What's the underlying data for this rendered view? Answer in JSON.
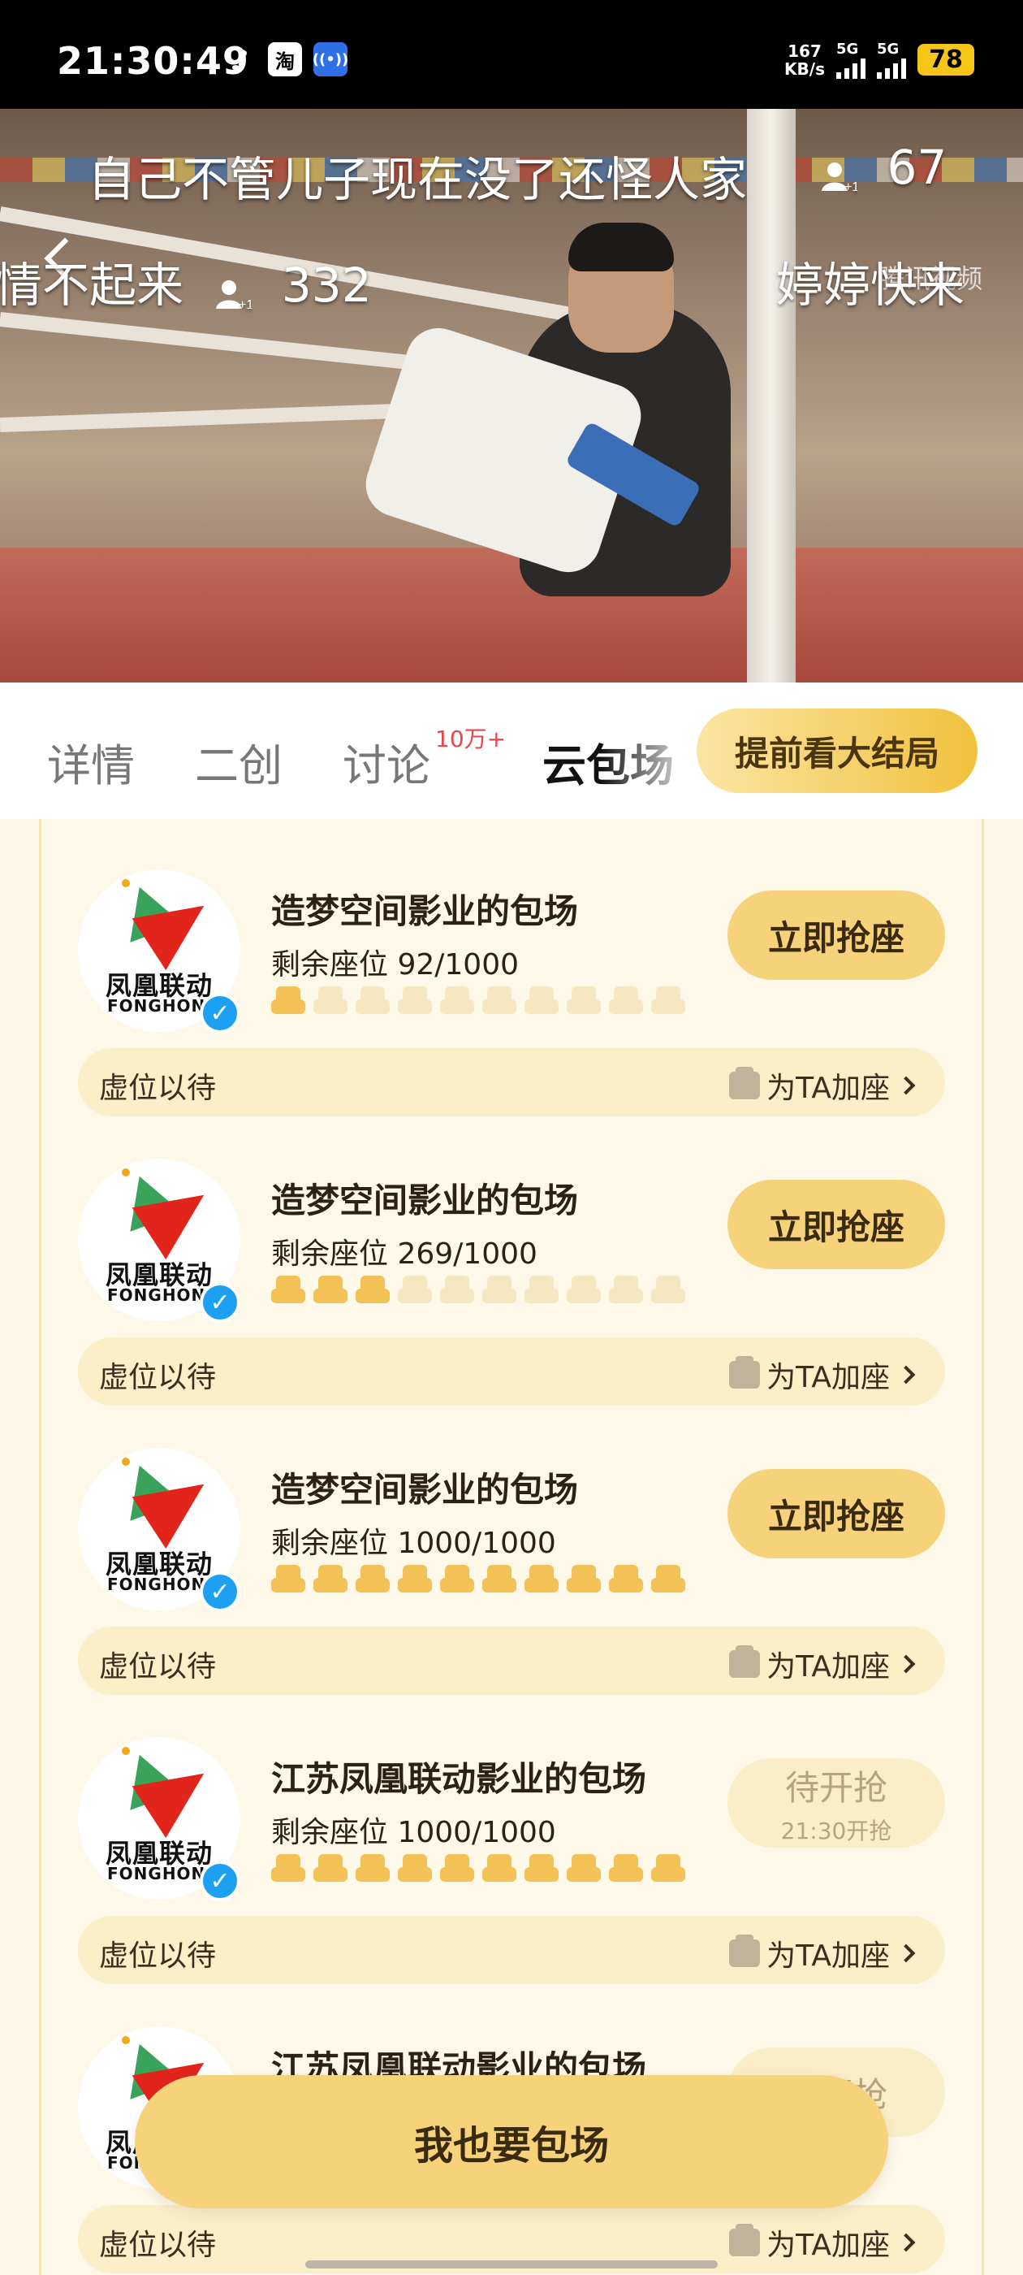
{
  "status_bar": {
    "time": "21:30:49",
    "net_speed_value": "167",
    "net_speed_unit": "KB/s",
    "sim1": "5G",
    "sim2": "5G",
    "battery": "78",
    "app_icons": [
      "tiktok-icon",
      "taobao-icon",
      "nfc-icon"
    ],
    "taobao_label": "淘",
    "nfc_label": "((•))",
    "tiktok_label": "♪"
  },
  "video": {
    "danmaku": [
      {
        "text": "自己不管儿子现在没了还怪人家"
      },
      {
        "text": "情不起来",
        "count": "332"
      },
      {
        "text": "婷婷快来"
      }
    ],
    "watermark": "腾讯视频",
    "top_count": "67"
  },
  "tabs": {
    "items": [
      "详情",
      "二创",
      "讨论",
      "云包场"
    ],
    "active_index": 3,
    "discuss_badge": "10万+",
    "spoiler_button": "提前看大结局"
  },
  "logo": {
    "cn": "凤凰联动",
    "en": "FONGHONG"
  },
  "cards": [
    {
      "title": "造梦空间影业的包场",
      "seats": "剩余座位 92/1000",
      "filled": 1,
      "button": "立即抢座",
      "foot_left": "虚位以待",
      "foot_right": "为TA加座"
    },
    {
      "title": "造梦空间影业的包场",
      "seats": "剩余座位 269/1000",
      "filled": 3,
      "button": "立即抢座",
      "foot_left": "虚位以待",
      "foot_right": "为TA加座"
    },
    {
      "title": "造梦空间影业的包场",
      "seats": "剩余座位 1000/1000",
      "filled": 10,
      "button": "立即抢座",
      "foot_left": "虚位以待",
      "foot_right": "为TA加座"
    },
    {
      "title": "江苏凤凰联动影业的包场",
      "seats": "剩余座位 1000/1000",
      "filled": 10,
      "button": "待开抢",
      "button_sub": "21:30开抢",
      "foot_left": "虚位以待",
      "foot_right": "为TA加座"
    },
    {
      "title": "江苏凤凰联动影业的包场",
      "seats": "",
      "filled": 0,
      "button": "待开抢",
      "foot_left": "虚位以待",
      "foot_right": "为TA加座"
    }
  ],
  "fab_label": "我也要包场",
  "colors": {
    "accent": "#f6d27a",
    "seat_filled": "#f2c256",
    "seat_empty": "#f6e7c2",
    "badge": "#e5474a",
    "verified": "#1ea0f2"
  }
}
